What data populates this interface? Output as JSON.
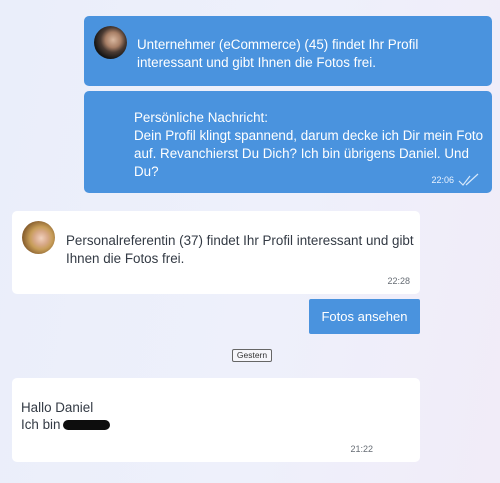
{
  "messages": [
    {
      "sender": "Unternehmer (eCommerce) (45)",
      "text": "Unternehmer (eCommerce) (45) findet Ihr Profil interessant und gibt Ihnen die Fotos frei."
    },
    {
      "heading": "Persönliche Nachricht:",
      "text": "Dein Profil klingt spannend, darum decke ich Dir mein Foto auf. Revanchierst Du Dich? Ich bin übrigens Daniel. Und Du?",
      "time": "22:06",
      "status_icon": "double-check-icon"
    },
    {
      "sender": "Personalreferentin (37)",
      "text": "Personalreferentin (37) findet Ihr Profil interessant und gibt Ihnen die Fotos frei.",
      "time": "22:28"
    },
    {
      "line1": "Hallo Daniel",
      "line2": "Ich bin",
      "time": "21:22"
    }
  ],
  "photos_button": "Fotos ansehen",
  "date_separator": "Gestern",
  "colors": {
    "accent": "#4a93de",
    "bubble_incoming": "#ffffff"
  }
}
